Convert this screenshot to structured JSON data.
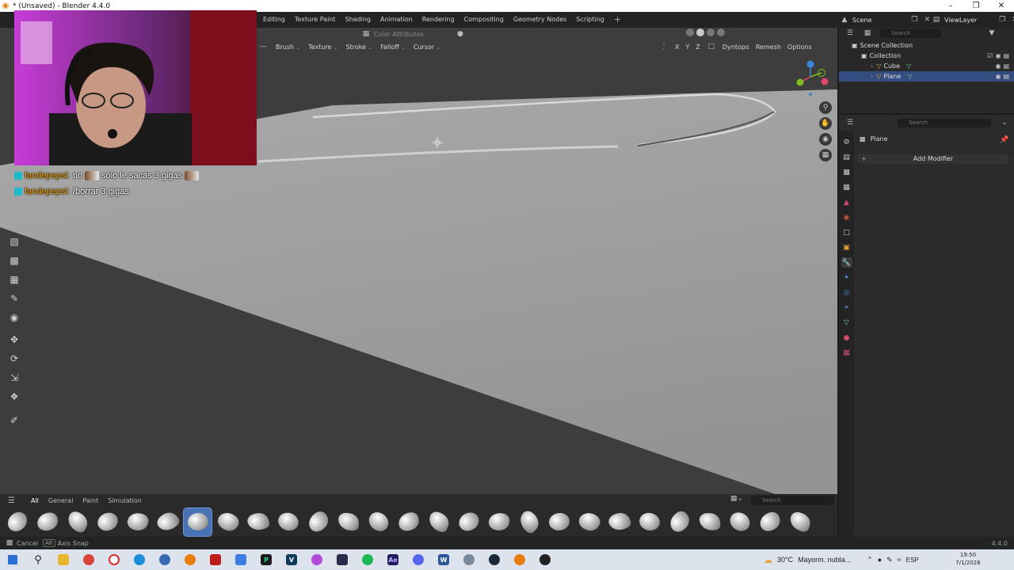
{
  "window": {
    "title": "* (Unsaved) - Blender 4.4.0",
    "controls": [
      "–",
      "❐",
      "✕"
    ]
  },
  "topbar": {
    "tabs": [
      "Editing",
      "Texture Paint",
      "Shading",
      "Animation",
      "Rendering",
      "Compositing",
      "Geometry Nodes",
      "Scripting",
      "+"
    ],
    "scene_label": "Scene",
    "view_layer_label": "ViewLayer"
  },
  "viewport": {
    "color_attributes_label": "Color Attributes",
    "tool_menus": [
      "Brush",
      "Texture",
      "Stroke",
      "Falloff",
      "Cursor"
    ],
    "axes": [
      "X",
      "Y",
      "Z"
    ],
    "dyntopo_label": "Dyntopo",
    "remesh_label": "Remesh",
    "options_label": "Options",
    "gizmo_axes": {
      "x": "X",
      "y": "Y",
      "z": "Z"
    },
    "colors": {
      "background": "#3d3d3d",
      "plane": "#9e9e9e",
      "active": "#4772b3"
    }
  },
  "chat": [
    {
      "user": "fandepepsi:",
      "message_a": "no",
      "message_b": "solo le sacas 3 gigas"
    },
    {
      "user": "fandepepsi:",
      "message_a": "/borrar 3 gigas",
      "message_b": ""
    }
  ],
  "asset_shelf": {
    "categories": [
      "All",
      "General",
      "Paint",
      "Simulation"
    ],
    "active_category": "All",
    "search_placeholder": "Search",
    "brush_count": 27,
    "active_brush_index": 6
  },
  "statusbar": {
    "cancel_label": "Cancel",
    "alt_key": "Alt",
    "axis_snap_label": "Axis Snap",
    "version": "4.4.0"
  },
  "outliner": {
    "search_placeholder": "Search",
    "rows": [
      {
        "label": "Scene Collection",
        "level": 0,
        "kind": "scene"
      },
      {
        "label": "Collection",
        "level": 1,
        "kind": "collection"
      },
      {
        "label": "Cube",
        "level": 2,
        "kind": "object"
      },
      {
        "label": "Plane",
        "level": 2,
        "kind": "object",
        "selected": true
      }
    ]
  },
  "properties": {
    "search_placeholder": "Search",
    "object_name": "Plane",
    "add_modifier_label": "Add Modifier"
  },
  "taskbar": {
    "weather": "30°C",
    "weather_text": "Mayorm. nubla...",
    "language": "ESP",
    "time": "19:50",
    "date": "7/1/2026"
  }
}
